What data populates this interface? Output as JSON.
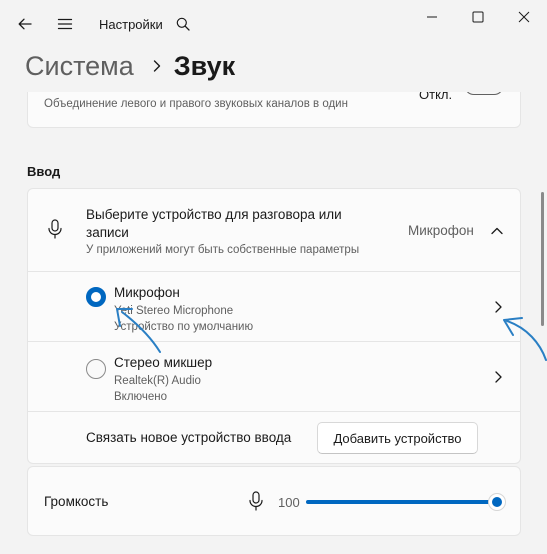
{
  "window": {
    "app_title": "Настройки",
    "controls": [
      "minimize-icon",
      "maximize-icon",
      "close-icon"
    ]
  },
  "breadcrumb": {
    "parent": "Система",
    "current": "Звук"
  },
  "mono_audio": {
    "description": "Объединение левого и правого звуковых каналов в один",
    "toggle_label": "Откл."
  },
  "input_section": {
    "label": "Ввод",
    "header": {
      "title": "Выберите устройство для разговора или записи",
      "subtitle": "У приложений могут быть собственные параметры",
      "selected_value": "Микрофон"
    },
    "devices": [
      {
        "name": "Микрофон",
        "line2": "Yeti Stereo Microphone",
        "line3": "Устройство по умолчанию",
        "selected": true
      },
      {
        "name": "Стерео микшер",
        "line2": "Realtek(R) Audio",
        "line3": "Включено",
        "selected": false
      }
    ],
    "pair_label": "Связать новое устройство ввода",
    "add_button": "Добавить устройство"
  },
  "volume": {
    "label": "Громкость",
    "value": "100",
    "level_percent": 100
  },
  "colors": {
    "accent": "#0067c0",
    "background": "#f3f3f3",
    "card": "#fbfbfb",
    "annotation": "#2a7fc4"
  }
}
